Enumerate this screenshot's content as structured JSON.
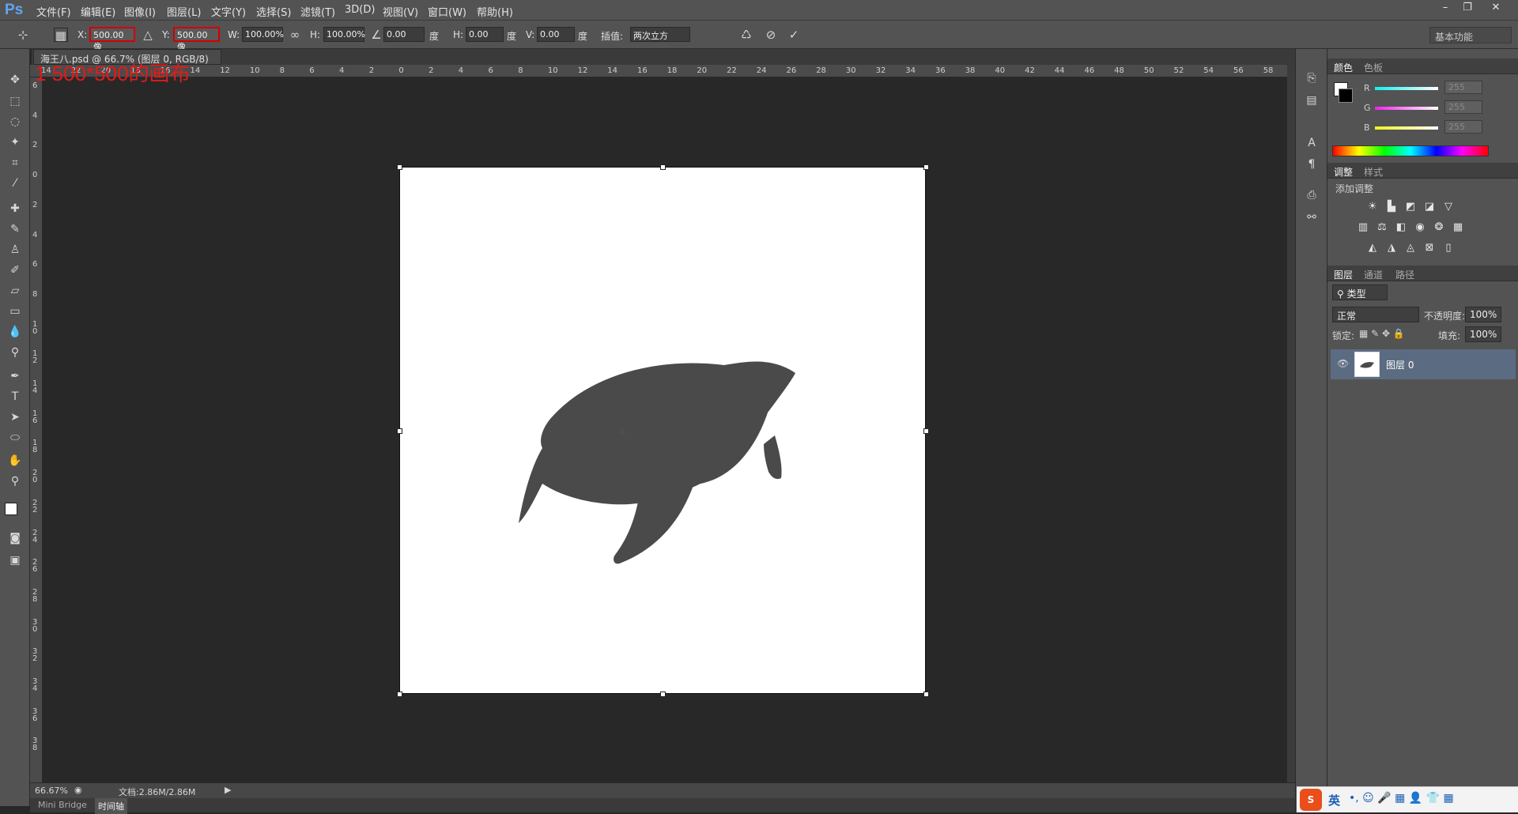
{
  "app": {
    "logo": "Ps"
  },
  "menu": [
    "文件(F)",
    "编辑(E)",
    "图像(I)",
    "图层(L)",
    "文字(Y)",
    "选择(S)",
    "滤镜(T)",
    "3D(D)",
    "视图(V)",
    "窗口(W)",
    "帮助(H)"
  ],
  "options": {
    "x_label": "X:",
    "x_value": "500.00 像",
    "y_label": "Y:",
    "y_value": "500.00 像",
    "w_label": "W:",
    "w_value": "100.00%",
    "h_label": "H:",
    "h_value": "100.00%",
    "angle_value": "0.00",
    "angle_unit": "度",
    "hskew_label": "H:",
    "hskew_value": "0.00",
    "hskew_unit": "度",
    "vskew_label": "V:",
    "vskew_value": "0.00",
    "vskew_unit": "度",
    "interp_label": "插值:",
    "interp_value": "两次立方"
  },
  "workspace": "基本功能",
  "document": {
    "tab_title": "海王八.psd @ 66.7% (图层 0, RGB/8) *",
    "tab_close": "×",
    "annotation": "1 500*500的画布"
  },
  "ruler_h_labels": [
    "14",
    "22",
    "20",
    "18",
    "16",
    "14",
    "12",
    "10",
    "8",
    "6",
    "4",
    "2",
    "0",
    "2",
    "4",
    "6",
    "8",
    "10",
    "12",
    "14",
    "16",
    "18",
    "20",
    "22",
    "24",
    "26",
    "28",
    "30",
    "32",
    "34",
    "36",
    "38",
    "40",
    "42",
    "44",
    "46",
    "48",
    "50",
    "52",
    "54",
    "56",
    "58"
  ],
  "ruler_v_labels": [
    "6",
    "4",
    "2",
    "0",
    "2",
    "4",
    "6",
    "8",
    "10",
    "12",
    "14",
    "16",
    "18",
    "20",
    "22",
    "24",
    "26",
    "28",
    "30",
    "32",
    "34",
    "36",
    "38"
  ],
  "status": {
    "zoom": "66.67%",
    "doc": "文档:2.86M/2.86M"
  },
  "bottom_tabs": [
    "Mini Bridge",
    "时间轴"
  ],
  "color_panel": {
    "tabs": [
      "颜色",
      "色板"
    ],
    "channels": [
      {
        "label": "R",
        "value": "255",
        "color": "#2ad4d4"
      },
      {
        "label": "G",
        "value": "255",
        "color": "#d42ad4"
      },
      {
        "label": "B",
        "value": "255",
        "color": "#e6e62a"
      }
    ]
  },
  "adjust_panel": {
    "tabs": [
      "调整",
      "样式"
    ],
    "subtitle": "添加调整"
  },
  "layers_panel": {
    "tabs": [
      "图层",
      "通道",
      "路径"
    ],
    "filter_kind": "类型",
    "blend_mode": "正常",
    "opacity_label": "不透明度:",
    "opacity_value": "100%",
    "lock_label": "锁定:",
    "fill_label": "填充:",
    "fill_value": "100%",
    "layer_name": "图层 0"
  },
  "ime": {
    "lang": "英"
  },
  "colors": {
    "turtle": "#4a4a4a",
    "accent_red": "#d40000",
    "selected_layer": "#5b6b82"
  }
}
